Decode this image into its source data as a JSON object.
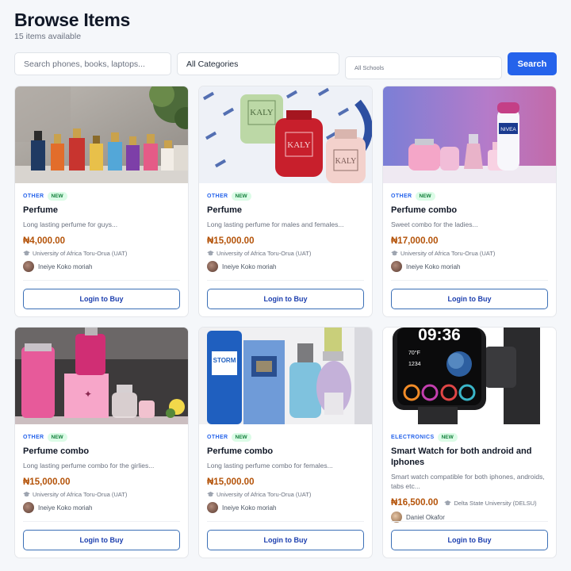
{
  "header": {
    "title": "Browse Items",
    "count": "15 items available"
  },
  "filters": {
    "search_placeholder": "Search phones, books, laptops...",
    "category": "All Categories",
    "school": "All Schools",
    "search_label": "Search"
  },
  "items": [
    {
      "category": "OTHER",
      "badge": "NEW",
      "title": "Perfume",
      "description": "Long lasting perfume for guys...",
      "price": "₦4,000.00",
      "school": "University of Africa Toru-Orua (UAT)",
      "seller": "Ineiye Koko moriah",
      "button": "Login to Buy"
    },
    {
      "category": "OTHER",
      "badge": "NEW",
      "title": "Perfume",
      "description": "Long lasting perfume for males and females...",
      "price": "₦15,000.00",
      "school": "University of Africa Toru-Orua (UAT)",
      "seller": "Ineiye Koko moriah",
      "button": "Login to Buy"
    },
    {
      "category": "OTHER",
      "badge": "NEW",
      "title": "Perfume combo",
      "description": "Sweet combo for the ladies...",
      "price": "₦17,000.00",
      "school": "University of Africa Toru-Orua (UAT)",
      "seller": "Ineiye Koko moriah",
      "button": "Login to Buy"
    },
    {
      "category": "OTHER",
      "badge": "NEW",
      "title": "Perfume combo",
      "description": "Long lasting perfume combo for the girlies...",
      "price": "₦15,000.00",
      "school": "University of Africa Toru-Orua (UAT)",
      "seller": "Ineiye Koko moriah",
      "button": "Login to Buy"
    },
    {
      "category": "OTHER",
      "badge": "NEW",
      "title": "Perfume combo",
      "description": "Long lasting perfume combo for females...",
      "price": "₦15,000.00",
      "school": "University of Africa Toru-Orua (UAT)",
      "seller": "Ineiye Koko moriah",
      "button": "Login to Buy"
    },
    {
      "category": "ELECTRONICS",
      "badge": "NEW",
      "title": "Smart Watch for both android and Iphones",
      "description": "Smart watch compatible for both iphones, androids, tabs etc...",
      "price": "₦16,500.00",
      "school": "Delta State University (DELSU)",
      "seller": "Daniel Okafor",
      "button": "Login to Buy"
    }
  ],
  "watch": {
    "time": "09:36",
    "temp": "70°F",
    "steps": "1234"
  },
  "bottle_labels": {
    "kaly": "KALY",
    "storm": "STORM",
    "nivea": "NIVEA"
  },
  "colors": {
    "accent": "#2563eb",
    "price": "#b45309",
    "badge_bg": "#dcfce7"
  }
}
